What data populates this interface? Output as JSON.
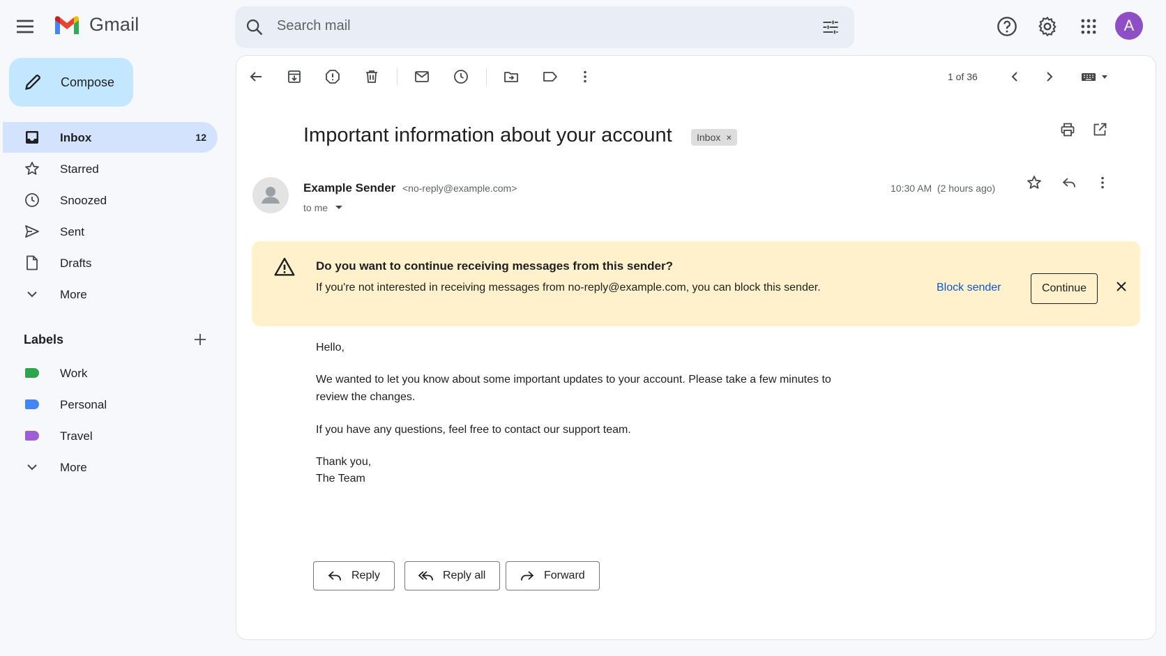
{
  "app": {
    "name": "Gmail"
  },
  "search": {
    "placeholder": "Search mail"
  },
  "user": {
    "avatar_letter": "A",
    "avatar_color": "#8e4ec6"
  },
  "sidebar": {
    "compose_label": "Compose",
    "items": [
      {
        "label": "Inbox",
        "count": "12",
        "icon": "inbox-icon",
        "active": true
      },
      {
        "label": "Starred",
        "icon": "star-icon"
      },
      {
        "label": "Snoozed",
        "icon": "clock-icon"
      },
      {
        "label": "Sent",
        "icon": "send-icon"
      },
      {
        "label": "Drafts",
        "icon": "draft-icon"
      },
      {
        "label": "More",
        "icon": "chevron-down-icon"
      }
    ],
    "labels_title": "Labels",
    "labels": [
      {
        "label": "Work",
        "color": "#2da44e"
      },
      {
        "label": "Personal",
        "color": "#4285f4"
      },
      {
        "label": "Travel",
        "color": "#9c5fd4"
      }
    ],
    "labels_more": "More"
  },
  "toolbar": {
    "pager": "1 of 36"
  },
  "email": {
    "subject": "Important information about your account",
    "chip_label": "Inbox",
    "chip_close": "×",
    "sender_name": "Example Sender",
    "sender_email": "<no-reply@example.com>",
    "to": "to me",
    "time": "10:30 AM  (2 hours ago)",
    "body": {
      "greeting": "Hello,",
      "p1_line1": "We wanted to let you know about some important updates to your account. Please take a few minutes to",
      "p1_line2": "review the changes.",
      "p2": "If you have any questions, feel free to contact our support team.",
      "signoff1": "Thank you,",
      "signoff2": "The Team"
    }
  },
  "banner": {
    "title": "Do you want to continue receiving messages from this sender?",
    "text": "If you're not interested in receiving messages from no-reply@example.com, you can block this sender.",
    "block_label": "Block sender",
    "continue_label": "Continue",
    "bg_color": "#fef1cc"
  },
  "actions": {
    "reply": "Reply",
    "reply_all": "Reply all",
    "forward": "Forward"
  }
}
